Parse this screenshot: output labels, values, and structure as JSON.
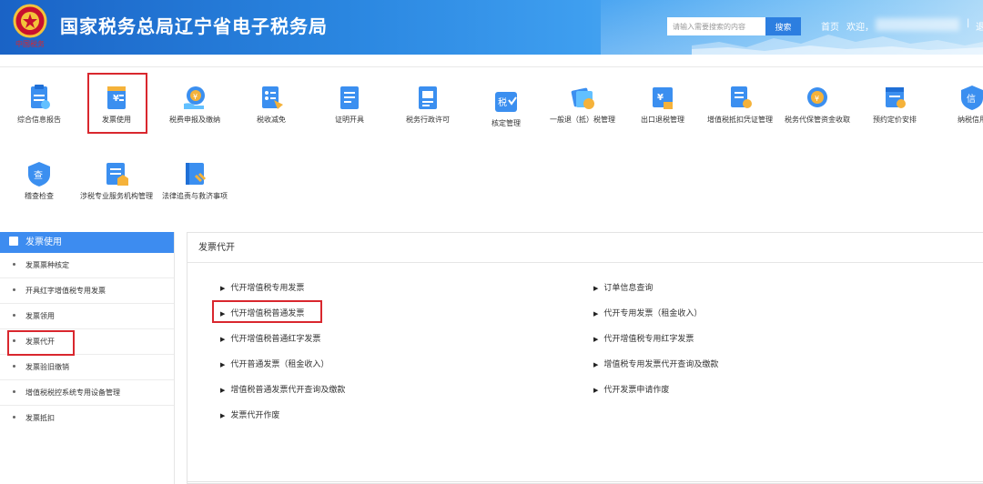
{
  "header": {
    "title": "国家税务总局辽宁省电子税务局",
    "search_placeholder": "请输入需要搜索的内容",
    "search_button": "搜索",
    "home_link": "首页",
    "welcome": "欢迎，",
    "separator": "|",
    "exit_partial": "退",
    "emblem_text": "中国税务"
  },
  "colors": {
    "header_primary": "#1a63c6",
    "accent_blue": "#3d8cf0",
    "highlight_red": "#d9272e"
  },
  "menu_icons": [
    {
      "label": "综合信息报告",
      "icon": "report-icon"
    },
    {
      "label": "发票使用",
      "icon": "invoice-icon",
      "highlighted": true
    },
    {
      "label": "税费申报及缴纳",
      "icon": "tax-payment-icon"
    },
    {
      "label": "税收减免",
      "icon": "tax-reduction-icon"
    },
    {
      "label": "证明开具",
      "icon": "certificate-icon"
    },
    {
      "label": "税务行政许可",
      "icon": "admin-permit-icon"
    },
    {
      "label": "核定管理",
      "icon": "assessment-icon"
    },
    {
      "label": "一般退（抵）税管理",
      "icon": "refund-icon"
    },
    {
      "label": "出口退税管理",
      "icon": "export-refund-icon"
    },
    {
      "label": "增值税抵扣凭证管理",
      "icon": "vat-deduction-icon"
    },
    {
      "label": "税务代保管资金收取",
      "icon": "custody-funds-icon"
    },
    {
      "label": "预约定价安排",
      "icon": "pricing-arrangement-icon"
    },
    {
      "label": "纳税信用",
      "icon": "credit-icon"
    },
    {
      "label": "稽查检查",
      "icon": "inspection-icon"
    },
    {
      "label": "涉税专业服务机构管理",
      "icon": "agency-management-icon"
    },
    {
      "label": "法律追责与救济事项",
      "icon": "legal-remedy-icon"
    }
  ],
  "sidebar": {
    "title": "发票使用",
    "items": [
      {
        "label": "发票票种核定"
      },
      {
        "label": "开具红字增值税专用发票"
      },
      {
        "label": "发票领用"
      },
      {
        "label": "发票代开",
        "highlighted": true
      },
      {
        "label": "发票验旧缴销"
      },
      {
        "label": "增值税税控系统专用设备管理"
      },
      {
        "label": "发票抵扣"
      }
    ]
  },
  "panel": {
    "title": "发票代开",
    "left_links": [
      {
        "label": "代开增值税专用发票"
      },
      {
        "label": "代开增值税普通发票",
        "highlighted": true
      },
      {
        "label": "代开增值税普通红字发票"
      },
      {
        "label": "代开普通发票（租金收入）"
      },
      {
        "label": "增值税普通发票代开查询及缴款"
      },
      {
        "label": "发票代开作废"
      }
    ],
    "right_links": [
      {
        "label": "订单信息查询"
      },
      {
        "label": "代开专用发票（租金收入）"
      },
      {
        "label": "代开增值税专用红字发票"
      },
      {
        "label": "增值税专用发票代开查询及缴款"
      },
      {
        "label": "代开发票申请作废"
      }
    ],
    "arrow": "▶"
  }
}
